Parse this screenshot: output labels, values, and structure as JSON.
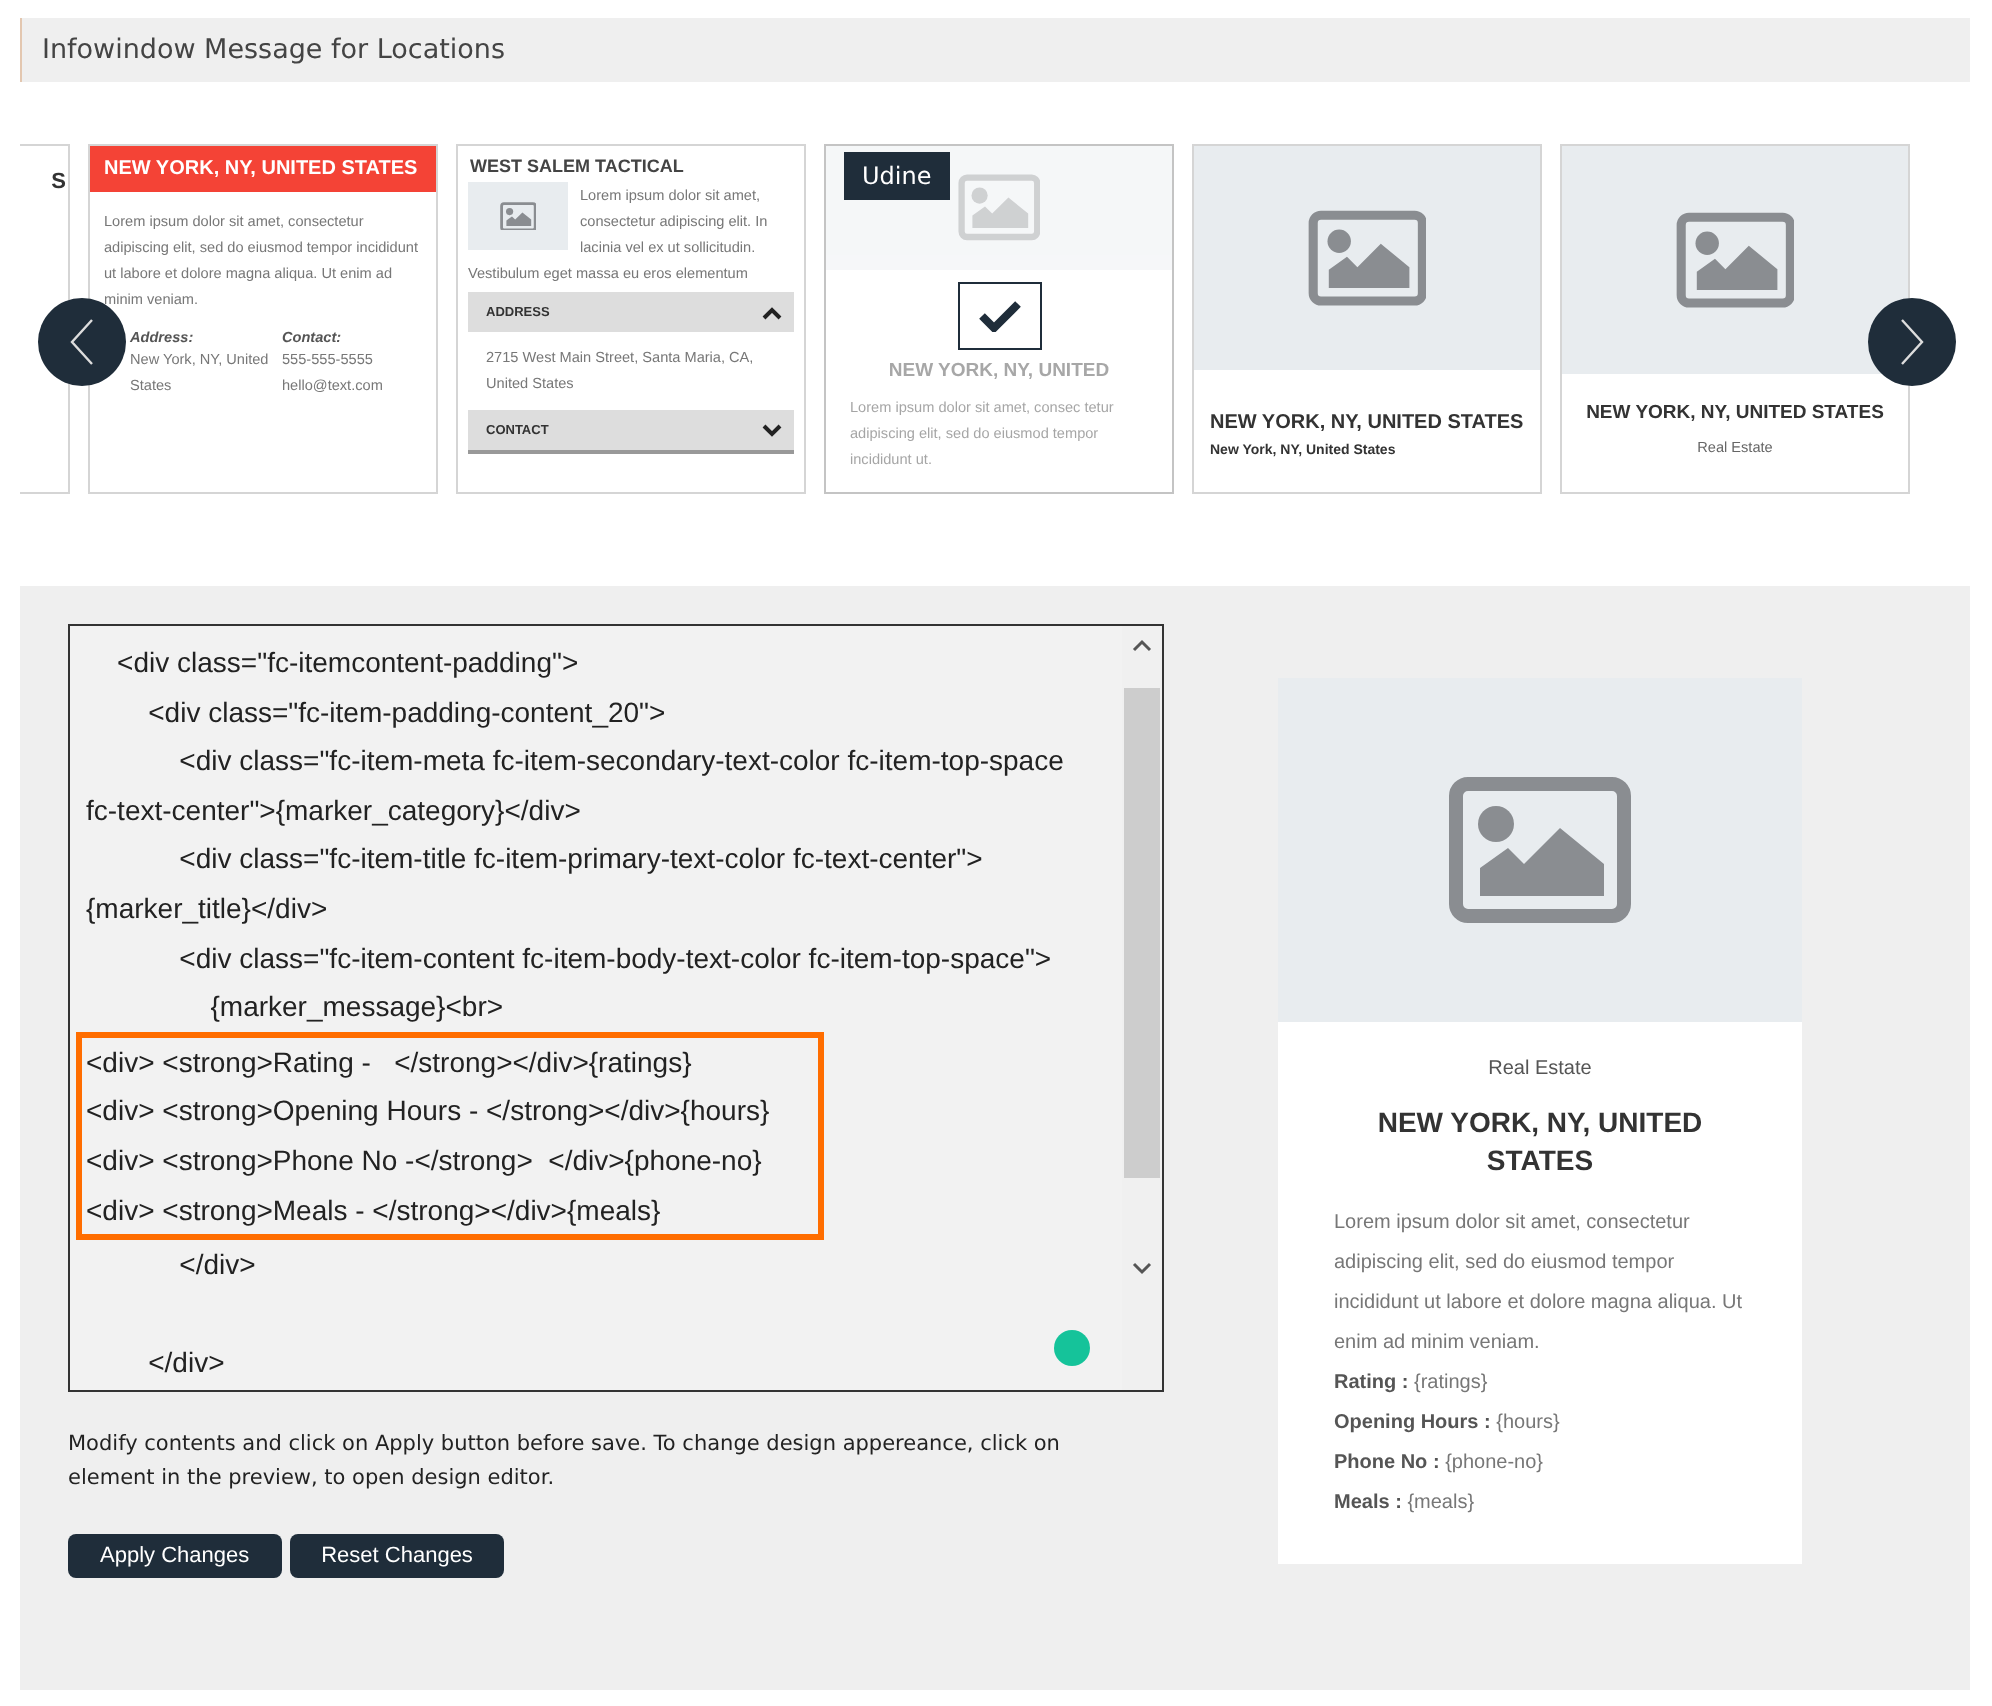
{
  "header": {
    "title": "Infowindow Message for Locations"
  },
  "carousel": {
    "cards": [
      {
        "kind": "partial",
        "selected": false,
        "title": "S"
      },
      {
        "kind": "banner",
        "selected": false,
        "title": "NEW YORK, NY, UNITED STATES",
        "body": "Lorem ipsum dolor sit amet, consectetur adipiscing elit, sed do eiusmod tempor incididunt ut labore et dolore magna aliqua. Ut enim ad minim veniam.",
        "fields": [
          {
            "label": "Address:",
            "value": "New York, NY, United States"
          },
          {
            "label": "Contact:",
            "value": "555-555-5555 hello@text.com"
          }
        ]
      },
      {
        "kind": "accordion",
        "selected": false,
        "title": "WEST SALEM TACTICAL",
        "body": "Lorem ipsum dolor sit amet, consectetur adipiscing elit. In lacinia vel ex ut sollicitudin.",
        "body_more": "Vestibulum eget massa eu eros elementum",
        "sections": [
          {
            "label": "ADDRESS",
            "expanded": true,
            "content": "2715 West Main Street, Santa Maria, CA, United States"
          },
          {
            "label": "CONTACT",
            "expanded": false
          }
        ]
      },
      {
        "kind": "image-faded",
        "selected": true,
        "tag": "Udine",
        "title": "NEW YORK, NY, UNITED",
        "body": "Lorem ipsum dolor sit amet, consec tetur adipiscing elit, sed do eiusmod tempor incididunt ut."
      },
      {
        "kind": "image-left",
        "selected": false,
        "title": "NEW YORK, NY, UNITED STATES",
        "subtitle": "New York, NY, United States"
      },
      {
        "kind": "image-center",
        "selected": false,
        "title": "NEW YORK, NY, UNITED STATES",
        "subtitle": "Real Estate"
      }
    ]
  },
  "editor": {
    "blocks": [
      {
        "highlighted": false,
        "blank_before": false,
        "lines": [
          "    <div class=\"fc-itemcontent-padding\">",
          "        <div class=\"fc-item-padding-content_20\">",
          "            <div class=\"fc-item-meta fc-item-secondary-text-color fc-item-top-space",
          "fc-text-center\">{marker_category}</div>",
          "            <div class=\"fc-item-title fc-item-primary-text-color fc-text-center\">",
          "{marker_title}</div>",
          "            <div class=\"fc-item-content fc-item-body-text-color fc-item-top-space\">",
          "                {marker_message}<br>"
        ]
      },
      {
        "highlighted": true,
        "blank_before": false,
        "lines": [
          "<div> <strong>Rating -   </strong></div>{ratings}",
          "<div> <strong>Opening Hours - </strong></div>{hours}",
          "<div> <strong>Phone No -</strong>  </div>{phone-no}",
          "<div> <strong>Meals - </strong></div>{meals}"
        ]
      },
      {
        "highlighted": false,
        "blank_before": false,
        "lines": [
          "            </div>"
        ]
      },
      {
        "highlighted": false,
        "blank_before": true,
        "lines": [
          "        </div>"
        ]
      }
    ]
  },
  "help_text": "Modify contents and click on Apply button before save. To change design appereance, click on element in the preview, to open design editor.",
  "buttons": [
    "Apply Changes",
    "Reset Changes"
  ],
  "preview": {
    "category": "Real Estate",
    "title": "NEW YORK, NY, UNITED STATES",
    "body": "Lorem ipsum dolor sit amet, consectetur adipiscing elit, sed do eiusmod tempor incididunt ut labore et dolore magna aliqua. Ut enim ad minim veniam.",
    "fields": [
      {
        "label": "Rating :",
        "value": "{ratings}"
      },
      {
        "label": "Opening Hours :",
        "value": "{hours}"
      },
      {
        "label": "Phone No :",
        "value": "{phone-no}"
      },
      {
        "label": "Meals :",
        "value": "{meals}"
      }
    ]
  }
}
